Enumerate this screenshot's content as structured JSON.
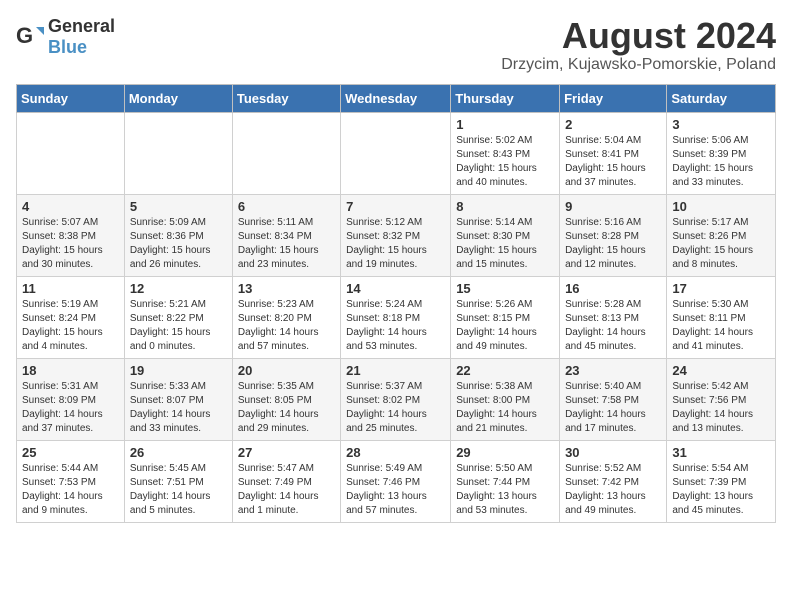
{
  "logo": {
    "general": "General",
    "blue": "Blue"
  },
  "title": {
    "month_year": "August 2024",
    "location": "Drzycim, Kujawsko-Pomorskie, Poland"
  },
  "headers": [
    "Sunday",
    "Monday",
    "Tuesday",
    "Wednesday",
    "Thursday",
    "Friday",
    "Saturday"
  ],
  "weeks": [
    [
      {
        "day": "",
        "info": ""
      },
      {
        "day": "",
        "info": ""
      },
      {
        "day": "",
        "info": ""
      },
      {
        "day": "",
        "info": ""
      },
      {
        "day": "1",
        "info": "Sunrise: 5:02 AM\nSunset: 8:43 PM\nDaylight: 15 hours\nand 40 minutes."
      },
      {
        "day": "2",
        "info": "Sunrise: 5:04 AM\nSunset: 8:41 PM\nDaylight: 15 hours\nand 37 minutes."
      },
      {
        "day": "3",
        "info": "Sunrise: 5:06 AM\nSunset: 8:39 PM\nDaylight: 15 hours\nand 33 minutes."
      }
    ],
    [
      {
        "day": "4",
        "info": "Sunrise: 5:07 AM\nSunset: 8:38 PM\nDaylight: 15 hours\nand 30 minutes."
      },
      {
        "day": "5",
        "info": "Sunrise: 5:09 AM\nSunset: 8:36 PM\nDaylight: 15 hours\nand 26 minutes."
      },
      {
        "day": "6",
        "info": "Sunrise: 5:11 AM\nSunset: 8:34 PM\nDaylight: 15 hours\nand 23 minutes."
      },
      {
        "day": "7",
        "info": "Sunrise: 5:12 AM\nSunset: 8:32 PM\nDaylight: 15 hours\nand 19 minutes."
      },
      {
        "day": "8",
        "info": "Sunrise: 5:14 AM\nSunset: 8:30 PM\nDaylight: 15 hours\nand 15 minutes."
      },
      {
        "day": "9",
        "info": "Sunrise: 5:16 AM\nSunset: 8:28 PM\nDaylight: 15 hours\nand 12 minutes."
      },
      {
        "day": "10",
        "info": "Sunrise: 5:17 AM\nSunset: 8:26 PM\nDaylight: 15 hours\nand 8 minutes."
      }
    ],
    [
      {
        "day": "11",
        "info": "Sunrise: 5:19 AM\nSunset: 8:24 PM\nDaylight: 15 hours\nand 4 minutes."
      },
      {
        "day": "12",
        "info": "Sunrise: 5:21 AM\nSunset: 8:22 PM\nDaylight: 15 hours\nand 0 minutes."
      },
      {
        "day": "13",
        "info": "Sunrise: 5:23 AM\nSunset: 8:20 PM\nDaylight: 14 hours\nand 57 minutes."
      },
      {
        "day": "14",
        "info": "Sunrise: 5:24 AM\nSunset: 8:18 PM\nDaylight: 14 hours\nand 53 minutes."
      },
      {
        "day": "15",
        "info": "Sunrise: 5:26 AM\nSunset: 8:15 PM\nDaylight: 14 hours\nand 49 minutes."
      },
      {
        "day": "16",
        "info": "Sunrise: 5:28 AM\nSunset: 8:13 PM\nDaylight: 14 hours\nand 45 minutes."
      },
      {
        "day": "17",
        "info": "Sunrise: 5:30 AM\nSunset: 8:11 PM\nDaylight: 14 hours\nand 41 minutes."
      }
    ],
    [
      {
        "day": "18",
        "info": "Sunrise: 5:31 AM\nSunset: 8:09 PM\nDaylight: 14 hours\nand 37 minutes."
      },
      {
        "day": "19",
        "info": "Sunrise: 5:33 AM\nSunset: 8:07 PM\nDaylight: 14 hours\nand 33 minutes."
      },
      {
        "day": "20",
        "info": "Sunrise: 5:35 AM\nSunset: 8:05 PM\nDaylight: 14 hours\nand 29 minutes."
      },
      {
        "day": "21",
        "info": "Sunrise: 5:37 AM\nSunset: 8:02 PM\nDaylight: 14 hours\nand 25 minutes."
      },
      {
        "day": "22",
        "info": "Sunrise: 5:38 AM\nSunset: 8:00 PM\nDaylight: 14 hours\nand 21 minutes."
      },
      {
        "day": "23",
        "info": "Sunrise: 5:40 AM\nSunset: 7:58 PM\nDaylight: 14 hours\nand 17 minutes."
      },
      {
        "day": "24",
        "info": "Sunrise: 5:42 AM\nSunset: 7:56 PM\nDaylight: 14 hours\nand 13 minutes."
      }
    ],
    [
      {
        "day": "25",
        "info": "Sunrise: 5:44 AM\nSunset: 7:53 PM\nDaylight: 14 hours\nand 9 minutes."
      },
      {
        "day": "26",
        "info": "Sunrise: 5:45 AM\nSunset: 7:51 PM\nDaylight: 14 hours\nand 5 minutes."
      },
      {
        "day": "27",
        "info": "Sunrise: 5:47 AM\nSunset: 7:49 PM\nDaylight: 14 hours\nand 1 minute."
      },
      {
        "day": "28",
        "info": "Sunrise: 5:49 AM\nSunset: 7:46 PM\nDaylight: 13 hours\nand 57 minutes."
      },
      {
        "day": "29",
        "info": "Sunrise: 5:50 AM\nSunset: 7:44 PM\nDaylight: 13 hours\nand 53 minutes."
      },
      {
        "day": "30",
        "info": "Sunrise: 5:52 AM\nSunset: 7:42 PM\nDaylight: 13 hours\nand 49 minutes."
      },
      {
        "day": "31",
        "info": "Sunrise: 5:54 AM\nSunset: 7:39 PM\nDaylight: 13 hours\nand 45 minutes."
      }
    ]
  ]
}
